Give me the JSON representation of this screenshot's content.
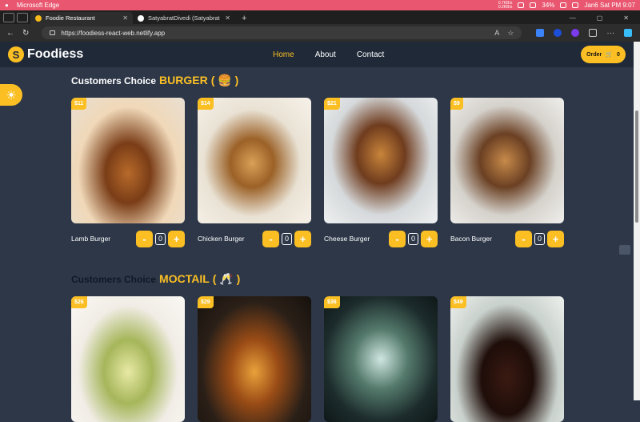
{
  "os": {
    "app_name": "Microsoft Edge",
    "net_up": "0.7KB/s",
    "net_down": "0.2KB/s",
    "battery": "34%",
    "clock": "Jan6 Sat PM 9:07"
  },
  "browser": {
    "tabs": [
      {
        "title": "Foodie Restaurant",
        "active": true
      },
      {
        "title": "SatyabratDivedi (Satyabrat Dived",
        "active": false
      }
    ],
    "url": "https://foodiess-react-web.netlify.app"
  },
  "site": {
    "brand": "Foodiess",
    "nav": [
      {
        "label": "Home",
        "active": true
      },
      {
        "label": "About"
      },
      {
        "label": "Contact"
      }
    ],
    "order_label": "Order",
    "cart_count": "0"
  },
  "sections": [
    {
      "prefix": "Customers Choice",
      "category": "BURGER",
      "emoji": "( 🍔 )",
      "items": [
        {
          "name": "Lamb Burger",
          "price": "$11",
          "qty": "0"
        },
        {
          "name": "Chicken Burger",
          "price": "$14",
          "qty": "0"
        },
        {
          "name": "Cheese Burger",
          "price": "$21",
          "qty": "0"
        },
        {
          "name": "Bacon Burger",
          "price": "$9",
          "qty": "0"
        }
      ]
    },
    {
      "prefix": "Customers Choice",
      "category": "MOCTAIL",
      "emoji": "( 🥂 )",
      "items": [
        {
          "price": "$26"
        },
        {
          "price": "$29"
        },
        {
          "price": "$36"
        },
        {
          "price": "$49"
        }
      ]
    }
  ],
  "controls": {
    "minus": "-",
    "plus": "+"
  },
  "icons": {
    "theme_toggle": "sun-icon",
    "cart": "cart-icon"
  },
  "colors": {
    "accent": "#fbbf24",
    "page_bg": "#2d3748",
    "nav_bg": "#1f2937"
  }
}
